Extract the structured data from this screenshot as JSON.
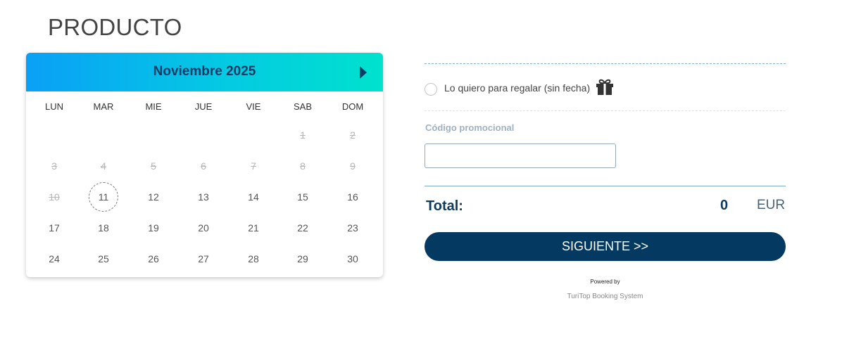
{
  "page": {
    "title": "PRODUCTO"
  },
  "calendar": {
    "month_label": "Noviembre 2025",
    "next_icon": "caret-right-icon",
    "weekdays": [
      "LUN",
      "MAR",
      "MIE",
      "JUE",
      "VIE",
      "SAB",
      "DOM"
    ],
    "days": [
      {
        "d": "1",
        "past": true
      },
      {
        "d": "2",
        "past": true
      },
      {
        "d": "3",
        "past": true
      },
      {
        "d": "4",
        "past": true
      },
      {
        "d": "5",
        "past": true
      },
      {
        "d": "6",
        "past": true
      },
      {
        "d": "7",
        "past": true
      },
      {
        "d": "8",
        "past": true
      },
      {
        "d": "9",
        "past": true
      },
      {
        "d": "10",
        "past": true
      },
      {
        "d": "11",
        "today": true
      },
      {
        "d": "12"
      },
      {
        "d": "13"
      },
      {
        "d": "14"
      },
      {
        "d": "15"
      },
      {
        "d": "16"
      },
      {
        "d": "17"
      },
      {
        "d": "18"
      },
      {
        "d": "19"
      },
      {
        "d": "20"
      },
      {
        "d": "21"
      },
      {
        "d": "22"
      },
      {
        "d": "23"
      },
      {
        "d": "24"
      },
      {
        "d": "25"
      },
      {
        "d": "26"
      },
      {
        "d": "27"
      },
      {
        "d": "28"
      },
      {
        "d": "29"
      },
      {
        "d": "30"
      }
    ],
    "first_weekday_index": 5,
    "header_gradient": [
      "#0aa0f6",
      "#00e2cd"
    ]
  },
  "gift": {
    "label": "Lo quiero para regalar",
    "sub_label": "(sin fecha)",
    "icon": "gift-icon",
    "checked": false
  },
  "promo": {
    "label": "Código promocional",
    "value": "",
    "placeholder": ""
  },
  "total": {
    "label": "Total:",
    "value": "0",
    "currency": "EUR"
  },
  "next_button": {
    "label": "SIGUIENTE >>",
    "color": "#043a62"
  },
  "footer": {
    "powered_by": "Powered by",
    "brand": "TuriTop Booking System"
  }
}
